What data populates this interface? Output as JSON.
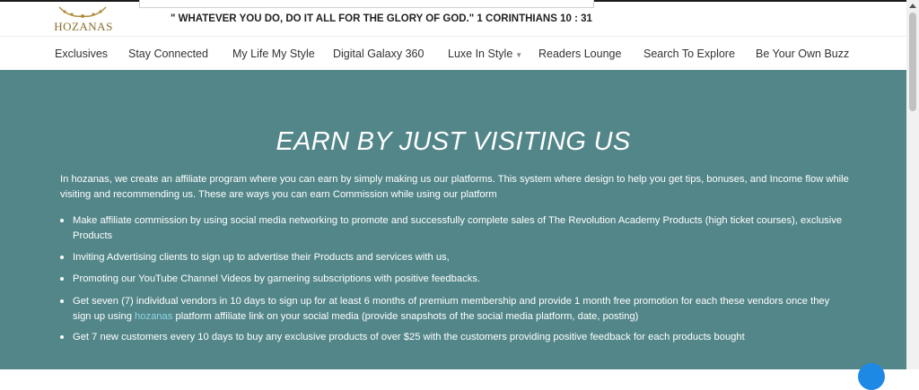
{
  "brand": {
    "name": "HOZANAS"
  },
  "header": {
    "quote": "\" WHATEVER YOU DO, DO IT ALL FOR THE GLORY OF GOD.\" 1 CORINTHIANS 10 : 31"
  },
  "nav": {
    "items": [
      {
        "label": "Exclusives"
      },
      {
        "label": "Stay Connected"
      },
      {
        "label": "My Life My Style"
      },
      {
        "label": "Digital Galaxy 360"
      },
      {
        "label": "Luxe In Style",
        "has_dropdown": true
      },
      {
        "label": "Readers Lounge"
      },
      {
        "label": "Search To Explore"
      },
      {
        "label": "Be Your Own Buzz"
      }
    ]
  },
  "hero": {
    "title": "EARN BY JUST VISITING US",
    "intro": "In hozanas, we create an affiliate program where you can earn by simply making us our platforms. This system where design to help you get tips, bonuses, and Income flow while visiting and recommending us. These are ways you can earn Commission while using our platform",
    "items": [
      {
        "text": "Make affiliate commission by using social media networking to promote and successfully complete sales of The Revolution Academy Products (high ticket courses), exclusive Products"
      },
      {
        "text": "Inviting Advertising clients to sign up to advertise their Products and services with us,"
      },
      {
        "text": "Promoting our YouTube Channel Videos by garnering subscriptions with positive feedbacks."
      },
      {
        "text_before": "Get seven (7) individual vendors in 10 days to sign up for at least 6 months of premium membership and provide 1 month free promotion for each these vendors once they sign up using ",
        "link": "hozanas",
        "text_after": " platform affiliate link on your social media (provide snapshots of the social media platform, date, posting)"
      },
      {
        "text": "Get 7 new customers every 10 days to buy any exclusive products of over $25 with the customers providing positive feedback for each products bought"
      }
    ]
  },
  "colors": {
    "hero_bg": "#538689",
    "link": "#8fd6e4",
    "logo_gold": "#8a6d2d"
  }
}
